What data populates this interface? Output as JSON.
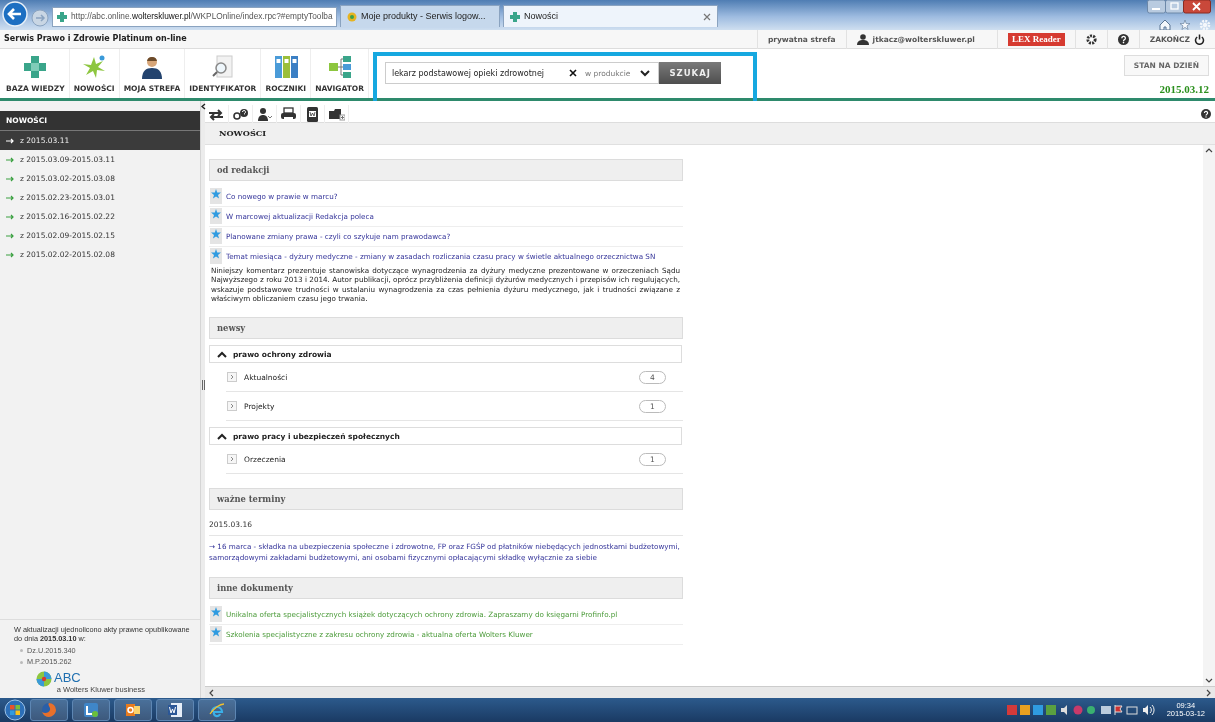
{
  "browser": {
    "url": "http://abc.online.**wolterskluwer.pl**/WKPLOnline/index.rpc?#emptyToolba",
    "tabs": [
      {
        "label": "Moje produkty - Serwis logow...",
        "selected": false
      },
      {
        "label": "Nowości",
        "selected": true
      }
    ]
  },
  "app": {
    "title": "Serwis Prawo i Zdrowie Platinum on-line",
    "private_zone": "prywatna strefa",
    "user": "jtkacz@wolterskluwer.pl",
    "reader": "LEX Reader",
    "logout": "ZAKOŃCZ"
  },
  "toolbar": [
    {
      "label": "BAZA WIEDZY",
      "kind": "plus"
    },
    {
      "label": "NOWOŚCI",
      "kind": "burst"
    },
    {
      "label": "MOJA STREFA",
      "kind": "person"
    },
    {
      "label": "IDENTYFIKATOR",
      "kind": "magnifier"
    },
    {
      "label": "ROCZNIKI",
      "kind": "binders"
    },
    {
      "label": "NAVIGATOR",
      "kind": "tree"
    }
  ],
  "search": {
    "value": "lekarz podstawowej opieki zdrowotnej",
    "scope": "w produkcie",
    "button": "SZUKAJ"
  },
  "date_panel": {
    "label": "STAN NA DZIEŃ",
    "date": "2015.03.12"
  },
  "sidebar": {
    "title": "NOWOŚCI",
    "items": [
      {
        "label": "z 2015.03.11",
        "selected": true
      },
      {
        "label": "z 2015.03.09-2015.03.11",
        "selected": false
      },
      {
        "label": "z 2015.03.02-2015.03.08",
        "selected": false
      },
      {
        "label": "z 2015.02.23-2015.03.01",
        "selected": false
      },
      {
        "label": "z 2015.02.16-2015.02.22",
        "selected": false
      },
      {
        "label": "z 2015.02.09-2015.02.15",
        "selected": false
      },
      {
        "label": "z 2015.02.02-2015.02.08",
        "selected": false
      }
    ],
    "note": "W aktualizacji ujednolicono akty prawne opublikowane do dnia **2015.03.10** w:",
    "links": [
      "Dz.U.2015.340",
      "M.P.2015.262"
    ],
    "logo": {
      "name": "ABC",
      "tagline": "a Wolters Kluwer business"
    }
  },
  "main": {
    "title": "NOWOŚCI",
    "sections": [
      {
        "kind": "articles",
        "title": "od redakcji",
        "items": [
          {
            "title": "Co nowego w prawie w marcu?"
          },
          {
            "title": "W marcowej aktualizacji Redakcja poleca"
          },
          {
            "title": "Planowane zmiany prawa - czyli co szykuje nam prawodawca?"
          },
          {
            "title": "Temat miesiąca - dyżury medyczne - zmiany w zasadach rozliczania czasu pracy w świetle aktualnego orzecznictwa SN",
            "summary": "Niniejszy komentarz prezentuje stanowiska dotyczące wynagrodzenia za dyżury medyczne prezentowane w orzeczeniach Sądu Najwyższego z roku 2013 i 2014. Autor publikacji, oprócz przybliżenia definicji dyżurów medycznych i przepisów ich regulujących, wskazuje podstawowe trudności w ustalaniu wynagrodzenia za czas pełnienia dyżuru medycznego, jak i trudności związane z właściwym obliczaniem czasu jego trwania."
          }
        ]
      },
      {
        "kind": "news",
        "title": "newsy",
        "groups": [
          {
            "title": "prawo ochrony zdrowia",
            "expanded": true,
            "items": [
              {
                "label": "Aktualności",
                "count": "4"
              },
              {
                "label": "Projekty",
                "count": "1"
              }
            ]
          },
          {
            "title": "prawo pracy i ubezpieczeń społecznych",
            "expanded": true,
            "items": [
              {
                "label": "Orzeczenia",
                "count": "1"
              }
            ]
          }
        ]
      },
      {
        "kind": "dates",
        "title": "ważne terminy",
        "date": "2015.03.16",
        "items": [
          "→ 16 marca - składka na ubezpieczenia społeczne i zdrowotne, FP oraz FGŚP od płatników niebędących jednostkami budżetowymi, samorządowymi zakładami budżetowymi, ani osobami fizycznymi opłacającymi składkę wyłącznie za siebie"
        ]
      },
      {
        "kind": "links",
        "title": "inne dokumenty",
        "items": [
          {
            "title": "Unikalna oferta specjalistycznych książek dotyczących ochrony zdrowia. Zapraszamy do księgarni Profinfo.pl"
          },
          {
            "title": "Szkolenia specjalistyczne z zakresu ochrony zdrowia - aktualna oferta Wolters Kluwer"
          }
        ]
      }
    ]
  },
  "taskbar": {
    "time": "09:34",
    "date": "2015-03-12"
  }
}
